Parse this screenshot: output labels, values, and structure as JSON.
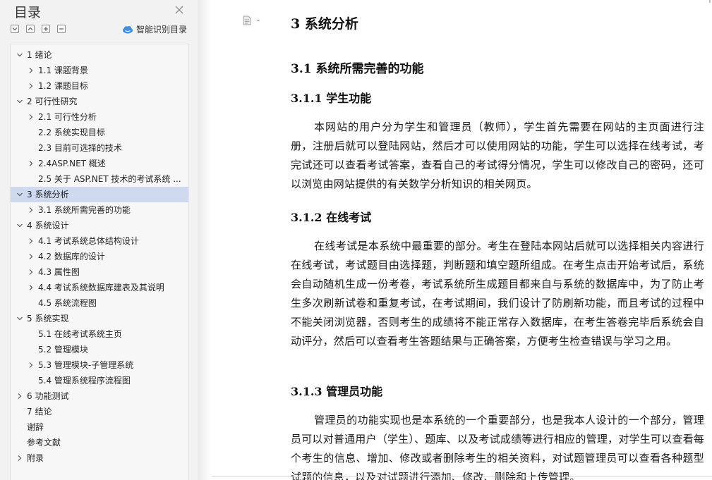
{
  "toc": {
    "title": "目录",
    "smart_label": "智能识别目录",
    "items": [
      {
        "label": "1 绪论",
        "level": 1,
        "chevron": "down"
      },
      {
        "label": "1.1 课题背景",
        "level": 2,
        "chevron": "right"
      },
      {
        "label": "1.2 课题目标",
        "level": 2,
        "chevron": "right"
      },
      {
        "label": "2 可行性研究",
        "level": 1,
        "chevron": "down"
      },
      {
        "label": "2.1 可行性分析",
        "level": 2,
        "chevron": "right"
      },
      {
        "label": "2.2 系统实现目标",
        "level": 2,
        "chevron": "none"
      },
      {
        "label": "2.3 目前可选择的技术",
        "level": 2,
        "chevron": "none"
      },
      {
        "label": "2.4ASP.NET 概述",
        "level": 2,
        "chevron": "right"
      },
      {
        "label": "2.5 关于 ASP.NET 技术的考试系统 ...",
        "level": 2,
        "chevron": "none"
      },
      {
        "label": "3 系统分析",
        "level": 1,
        "chevron": "down",
        "selected": true
      },
      {
        "label": "3.1 系统所需完善的功能",
        "level": 2,
        "chevron": "right"
      },
      {
        "label": "4 系统设计",
        "level": 1,
        "chevron": "down"
      },
      {
        "label": "4.1 考试系统总体结构设计",
        "level": 2,
        "chevron": "right"
      },
      {
        "label": "4.2 数据库的设计",
        "level": 2,
        "chevron": "right"
      },
      {
        "label": "4.3 属性图",
        "level": 2,
        "chevron": "right"
      },
      {
        "label": "4.4 考试系统数据库建表及其说明",
        "level": 2,
        "chevron": "right"
      },
      {
        "label": "4.5 系统流程图",
        "level": 2,
        "chevron": "none"
      },
      {
        "label": "5 系统实现",
        "level": 1,
        "chevron": "down"
      },
      {
        "label": "5.1 在线考试系统主页",
        "level": 2,
        "chevron": "none"
      },
      {
        "label": "5.2 管理模块",
        "level": 2,
        "chevron": "none"
      },
      {
        "label": "5.3 管理模块-子管理系统",
        "level": 2,
        "chevron": "right"
      },
      {
        "label": "5.4 管理系统程序流程图",
        "level": 2,
        "chevron": "none"
      },
      {
        "label": "6 功能测试",
        "level": 1,
        "chevron": "right"
      },
      {
        "label": "7 结论",
        "level": 1,
        "chevron": "none"
      },
      {
        "label": "谢辞",
        "level": 1,
        "chevron": "none"
      },
      {
        "label": "参考文献",
        "level": 1,
        "chevron": "none"
      },
      {
        "label": "附录",
        "level": 1,
        "chevron": "right"
      }
    ]
  },
  "doc": {
    "h1": "3 系统分析",
    "h2": "3.1 系统所需完善的功能",
    "s1_title": "3.1.1 学生功能",
    "s1_text": "本网站的用户分为学生和管理员（教师），学生首先需要在网站的主页面进行注册，注册后就可以登陆网站，然后才可以使用网站的功能，学生可以选择在线考试，考完试还可以查看考试答案，查看自己的考试得分情况，学生可以修改自己的密码，还可以浏览由网站提供的有关数学分析知识的相关网页。",
    "s2_title": "3.1.2 在线考试",
    "s2_text": "在线考试是本系统中最重要的部分。考生在登陆本网站后就可以选择相关内容进行在线考试，考试题目由选择题，判断题和填空题所组成。在考生点击开始考试后，系统会自动随机生成一份考卷，考试系统所生成题目都来自与系统的数据库中，为了防止考生多次刷新试卷和重复考试，在考试期间，我们设计了防刷新功能，而且考试的过程中不能关闭浏览器，否则考生的成绩将不能正常存入数据库，在考生答卷完毕后系统会自动评分，然后可以查看考生答题结果与正确答案，方便考生检查错误与学习之用。",
    "s3_title": "3.1.3 管理员功能",
    "s3_text": "管理员的功能实现也是本系统的一个重要部分，也是我本人设计的一个部分，管理员可以对普通用户（学生）、题库、以及考试成绩等进行相应的管理，对学生可以查看每个考生的信息、增加、修改或者删除考生的相关资料，对试题管理员可以查看各种题型试题的信息，以及对试题进行添加、修改、删除和上传管理。"
  },
  "colors": {
    "panel_bg": "#f2f2f2",
    "tree_bg": "#f7f7f7",
    "selected_bg": "#cfd9ef",
    "smart_icon": "#3d8fe8"
  }
}
